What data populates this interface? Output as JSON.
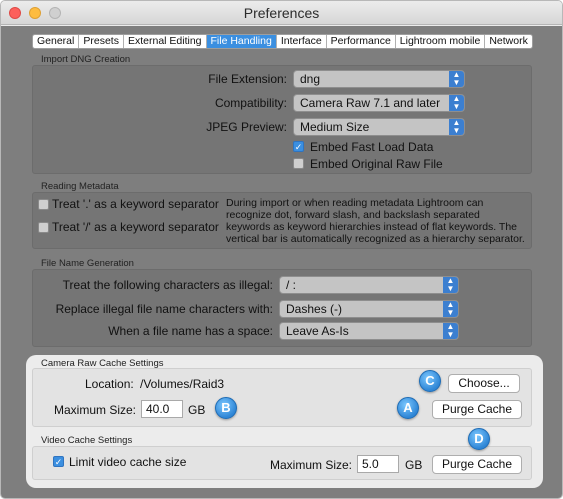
{
  "window": {
    "title": "Preferences"
  },
  "tabs": [
    {
      "label": "General"
    },
    {
      "label": "Presets"
    },
    {
      "label": "External Editing"
    },
    {
      "label": "File Handling"
    },
    {
      "label": "Interface"
    },
    {
      "label": "Performance"
    },
    {
      "label": "Lightroom mobile"
    },
    {
      "label": "Network"
    }
  ],
  "active_tab": "File Handling",
  "import_dng": {
    "section_title": "Import DNG Creation",
    "file_extension": {
      "label": "File Extension:",
      "value": "dng"
    },
    "compatibility": {
      "label": "Compatibility:",
      "value": "Camera Raw 7.1 and later"
    },
    "jpeg_preview": {
      "label": "JPEG Preview:",
      "value": "Medium Size"
    },
    "embed_fast_load": {
      "label": "Embed Fast Load Data",
      "checked": true
    },
    "embed_original_raw": {
      "label": "Embed Original Raw File",
      "checked": false
    }
  },
  "reading_metadata": {
    "section_title": "Reading Metadata",
    "dot_separator": {
      "label": "Treat '.' as a keyword separator",
      "checked": false
    },
    "slash_separator": {
      "label": "Treat '/' as a keyword separator",
      "checked": false
    },
    "description": "During import or when reading metadata Lightroom can recognize dot, forward slash, and backslash separated keywords as keyword hierarchies instead of flat keywords. The vertical bar is automatically recognized as a hierarchy separator."
  },
  "file_name_generation": {
    "section_title": "File Name Generation",
    "illegal_chars": {
      "label": "Treat the following characters as illegal:",
      "value": "/ :"
    },
    "replace_illegal": {
      "label": "Replace illegal file name characters with:",
      "value": "Dashes (-)"
    },
    "space_handling": {
      "label": "When a file name has a space:",
      "value": "Leave As-Is"
    }
  },
  "camera_raw_cache": {
    "section_title": "Camera Raw Cache Settings",
    "location_label": "Location:",
    "location_value": "/Volumes/Raid3",
    "choose_button": "Choose...",
    "max_size_label": "Maximum Size:",
    "max_size_value": "40.0",
    "max_size_unit": "GB",
    "purge_button": "Purge Cache"
  },
  "video_cache": {
    "section_title": "Video Cache Settings",
    "limit_label": "Limit video cache size",
    "limit_checked": true,
    "max_size_label": "Maximum Size:",
    "max_size_value": "5.0",
    "max_size_unit": "GB",
    "purge_button": "Purge Cache"
  },
  "callouts": {
    "a": "A",
    "b": "B",
    "c": "C",
    "d": "D"
  },
  "colors": {
    "accent": "#3b8fe0",
    "badge": "#2f86d6"
  }
}
